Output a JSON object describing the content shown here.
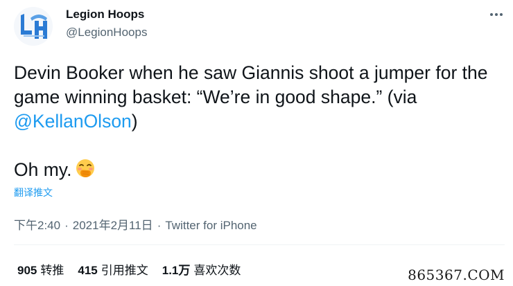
{
  "author": {
    "name": "Legion Hoops",
    "handle": "@LegionHoops",
    "avatar_icon": "legion-hoops-logo-icon"
  },
  "menu": {
    "icon": "more-horizontal-icon"
  },
  "tweet": {
    "line_1_text": "Devin Booker when he saw Giannis shoot a jumper for the game winning basket: “We’re in good shape.” (via ",
    "mention": "@KellanOlson",
    "line_1_close": ")",
    "line_2_text": "Oh my.",
    "emoji_icon": "face-with-hand-over-mouth-icon"
  },
  "translate_label": "翻译推文",
  "meta": {
    "time": "下午2:40",
    "separator": "·",
    "date": "2021年2月11日",
    "source": "Twitter for iPhone"
  },
  "stats": {
    "retweets_count": "905",
    "retweets_label": "转推",
    "quotes_count": "415",
    "quotes_label": "引用推文",
    "likes_count": "1.1万",
    "likes_label": "喜欢次数"
  },
  "watermark": "865367.COM",
  "colors": {
    "accent": "#1d9bf0",
    "text": "#0f1419",
    "muted": "#536471"
  }
}
